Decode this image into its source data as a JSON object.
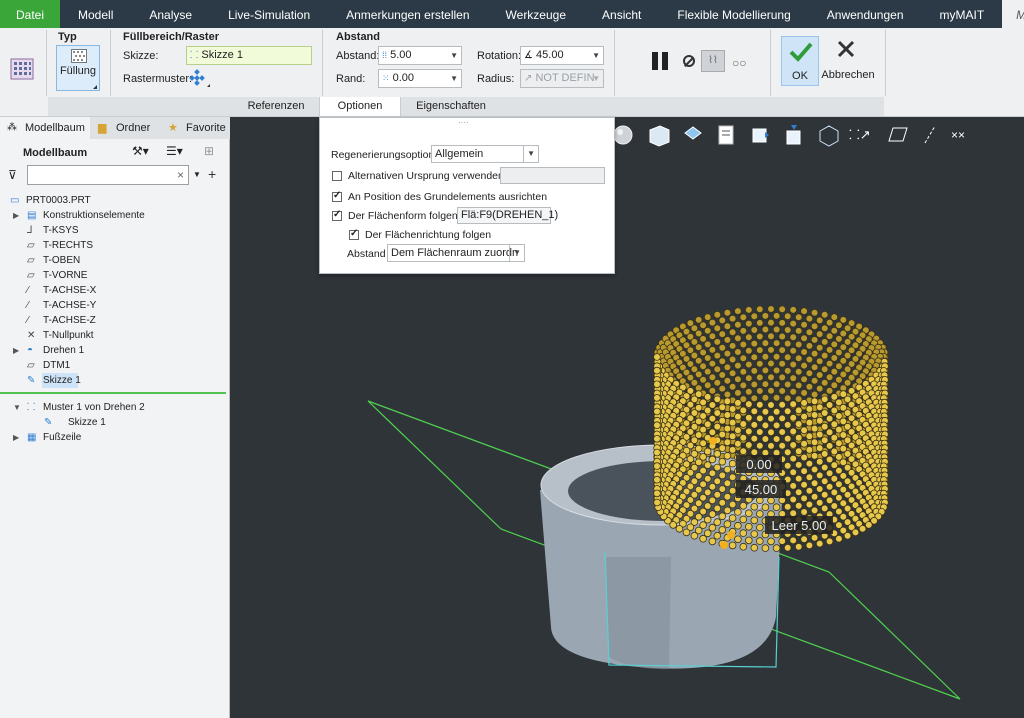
{
  "menu": [
    "Datei",
    "Modell",
    "Analyse",
    "Live-Simulation",
    "Anmerkungen erstellen",
    "Werkzeuge",
    "Ansicht",
    "Flexible Modellierung",
    "Anwendungen",
    "myMAIT",
    "Muster"
  ],
  "ribbon": {
    "typ": {
      "title": "Typ",
      "button": "Füllung"
    },
    "fill": {
      "title": "Füllbereich/Raster",
      "skizze_label": "Skizze:",
      "skizze_value": "Skizze 1",
      "raster_label": "Rastermuster:"
    },
    "abstand": {
      "title": "Abstand",
      "abstand_label": "Abstand:",
      "abstand_value": "5.00",
      "rand_label": "Rand:",
      "rand_value": "0.00",
      "rotation_label": "Rotation:",
      "rotation_value": "45.00",
      "radius_label": "Radius:",
      "radius_value": "NOT DEFIN"
    },
    "ok_label": "OK",
    "cancel_label": "Abbrechen",
    "subtabs": [
      "Referenzen",
      "Optionen",
      "Eigenschaften"
    ]
  },
  "left_panel": {
    "tabs": [
      "Modellbaum",
      "Ordner",
      "Favorite"
    ],
    "header": "Modellbaum",
    "tree": [
      {
        "label": "PRT0003.PRT",
        "icon": "part-icon",
        "indent": 0,
        "expand": ""
      },
      {
        "label": "Konstruktionselemente",
        "icon": "features-icon",
        "indent": 1,
        "expand": "▶"
      },
      {
        "label": "T-KSYS",
        "icon": "csys-icon",
        "indent": 1,
        "expand": ""
      },
      {
        "label": "T-RECHTS",
        "icon": "plane-icon",
        "indent": 1,
        "expand": ""
      },
      {
        "label": "T-OBEN",
        "icon": "plane-icon",
        "indent": 1,
        "expand": ""
      },
      {
        "label": "T-VORNE",
        "icon": "plane-icon",
        "indent": 1,
        "expand": ""
      },
      {
        "label": "T-ACHSE-X",
        "icon": "axis-icon",
        "indent": 1,
        "expand": ""
      },
      {
        "label": "T-ACHSE-Y",
        "icon": "axis-icon",
        "indent": 1,
        "expand": ""
      },
      {
        "label": "T-ACHSE-Z",
        "icon": "axis-icon",
        "indent": 1,
        "expand": ""
      },
      {
        "label": "T-Nullpunkt",
        "icon": "point-icon",
        "indent": 1,
        "expand": ""
      },
      {
        "label": "Drehen 1",
        "icon": "revolve-icon",
        "indent": 1,
        "expand": "▶"
      },
      {
        "label": "DTM1",
        "icon": "plane-icon",
        "indent": 1,
        "expand": ""
      },
      {
        "label": "Skizze 1",
        "icon": "sketch-icon",
        "indent": 1,
        "expand": ""
      },
      {
        "label": "Muster 1 von Drehen 2",
        "icon": "pattern-icon",
        "indent": 1,
        "expand": "▼"
      },
      {
        "label": "Skizze 1",
        "icon": "sketch-icon",
        "indent": 2,
        "expand": ""
      },
      {
        "label": "Fußzeile",
        "icon": "footer-icon",
        "indent": 1,
        "expand": "▶"
      }
    ]
  },
  "options_popup": {
    "regen_label": "Regenerierungsoption",
    "regen_value": "Allgemein",
    "alt_origin_label": "Alternativen Ursprung verwenden",
    "alt_origin_checked": false,
    "align_label": "An Position des Grundelements ausrichten",
    "align_checked": true,
    "follow_shape_label": "Der Flächenform folgen",
    "follow_shape_checked": true,
    "follow_shape_value": "Flä:F9(DREHEN_1)",
    "follow_dir_label": "Der Flächenrichtung folgen",
    "follow_dir_checked": true,
    "abstand_label": "Abstand",
    "abstand_value": "Dem Flächenraum zuordn"
  },
  "viewport": {
    "dim1": "0.00",
    "dim2": "45.00",
    "dim3": "Leer 5.00"
  },
  "colors": {
    "accent_green": "#3aa63a",
    "bead": "#e8c84a",
    "plane": "#4fd14f"
  }
}
